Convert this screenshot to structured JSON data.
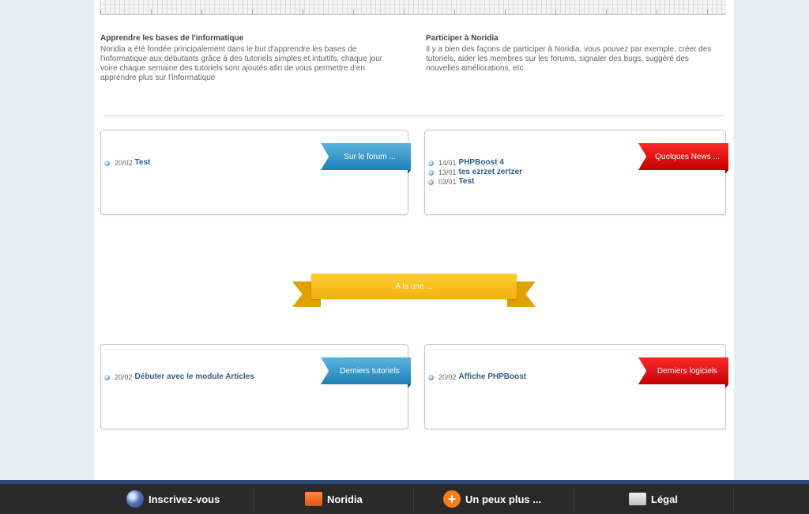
{
  "intro": {
    "left": {
      "title": "Apprendre les bases de l'informatique",
      "text": "Noridia a été fondée principalement dans le but d'apprendre les bases de l'informatique aux débutants grâce à des tutoriels simples et intuitifs, chaque jour voire chaque semaine des tutoriels sont ajoutés afin de vous permettre d'en apprendre plus sur l'informatique"
    },
    "right": {
      "title": "Participer à Noridia",
      "text": "Il y a bien des façons de participer à Noridia, vous pouvez par exemple, créer des tutoriels, aider les membres sur les forums, signaler des bugs, suggéré des nouvelles améliorations, etc."
    }
  },
  "forum": {
    "ribbon": "Sur le forum ...",
    "items": [
      {
        "date": "20/02",
        "title": "Test"
      }
    ]
  },
  "news": {
    "ribbon": "Quelques News ...",
    "items": [
      {
        "date": "14/01",
        "title": "PHPBoost 4"
      },
      {
        "date": "13/01",
        "title": "tes ezrzet zertzer"
      },
      {
        "date": "03/01",
        "title": "Test"
      }
    ]
  },
  "alaune": {
    "label": "A la une ..."
  },
  "tutoriels": {
    "ribbon": "Derniers tutoriels",
    "items": [
      {
        "date": "20/02",
        "title": "Débuter avec le module Articles"
      }
    ]
  },
  "logiciels": {
    "ribbon": "Derniers logiciels",
    "items": [
      {
        "date": "20/02",
        "title": "Affiche PHPBoost"
      }
    ]
  },
  "footer": {
    "items": [
      {
        "label": "Inscrivez-vous",
        "icon": "globe-icon"
      },
      {
        "label": "Noridia",
        "icon": "folder-icon"
      },
      {
        "label": "Un peux plus ...",
        "icon": "plus-icon"
      },
      {
        "label": "Légal",
        "icon": "document-icon"
      }
    ]
  },
  "colors": {
    "background": "#e8edf3",
    "ribbon_blue": "#2a8cc4",
    "ribbon_red": "#e00000",
    "ribbon_yellow": "#f5b818",
    "link": "#2e5f8f",
    "footer": "#2a2a2a",
    "footer_border": "#2b4a78"
  }
}
